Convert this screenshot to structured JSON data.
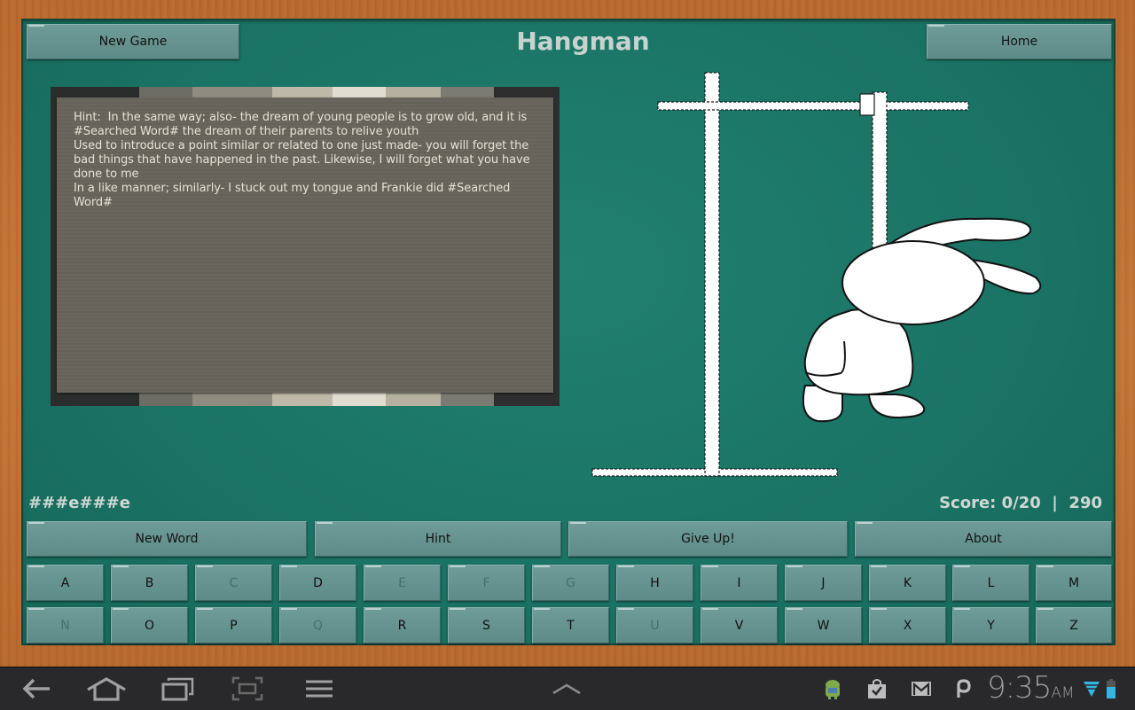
{
  "app": {
    "title": "Hangman"
  },
  "header": {
    "new_game_label": "New Game",
    "home_label": "Home"
  },
  "hint": {
    "text": "Hint:  In the same way; also- the dream of young people is to grow old, and it is\n#Searched Word# the dream of their parents to relive youth\nUsed to introduce a point similar or related to one just made- you will forget the\nbad things that have happened in the past. Likewise, I will forget what you have\ndone to me\nIn a like manner; similarly- I stuck out my tongue and Frankie did #Searched\nWord#"
  },
  "game": {
    "masked_word": "###e###e",
    "score_text": "Score: 0/20  |  290",
    "hangman_stage": "body drawn (head, ears, body, legs) on gallows"
  },
  "actions": {
    "new_word_label": "New Word",
    "hint_label": "Hint",
    "give_up_label": "Give Up!",
    "about_label": "About"
  },
  "keyboard": {
    "keys": [
      {
        "letter": "A",
        "enabled": true
      },
      {
        "letter": "B",
        "enabled": true
      },
      {
        "letter": "C",
        "enabled": false
      },
      {
        "letter": "D",
        "enabled": true
      },
      {
        "letter": "E",
        "enabled": false
      },
      {
        "letter": "F",
        "enabled": false
      },
      {
        "letter": "G",
        "enabled": false
      },
      {
        "letter": "H",
        "enabled": true
      },
      {
        "letter": "I",
        "enabled": true
      },
      {
        "letter": "J",
        "enabled": true
      },
      {
        "letter": "K",
        "enabled": true
      },
      {
        "letter": "L",
        "enabled": true
      },
      {
        "letter": "M",
        "enabled": true
      },
      {
        "letter": "N",
        "enabled": false
      },
      {
        "letter": "O",
        "enabled": true
      },
      {
        "letter": "P",
        "enabled": true
      },
      {
        "letter": "Q",
        "enabled": false
      },
      {
        "letter": "R",
        "enabled": true
      },
      {
        "letter": "S",
        "enabled": true
      },
      {
        "letter": "T",
        "enabled": true
      },
      {
        "letter": "U",
        "enabled": false
      },
      {
        "letter": "V",
        "enabled": true
      },
      {
        "letter": "W",
        "enabled": true
      },
      {
        "letter": "X",
        "enabled": true
      },
      {
        "letter": "Y",
        "enabled": true
      },
      {
        "letter": "Z",
        "enabled": true
      }
    ]
  },
  "system_bar": {
    "nav_icons": [
      "back-icon",
      "home-icon",
      "recent-apps-icon",
      "screenshot-icon",
      "menu-icon"
    ],
    "notification_icons": [
      "android-debug-icon",
      "play-store-update-icon",
      "gmail-icon",
      "pulse-icon"
    ],
    "time": "9:35",
    "ampm": "AM",
    "wifi_color": "#33b5e5",
    "battery_color": "#33b5e5"
  }
}
